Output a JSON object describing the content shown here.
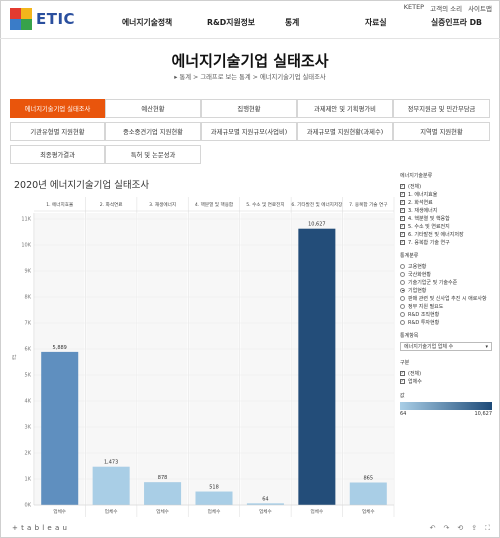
{
  "header": {
    "logo_text": "ETIC",
    "utility_links": [
      "KETEP",
      "고객의 소리",
      "사이트맵"
    ],
    "menu": [
      "에너지기술정책",
      "R&D지원정보",
      "통계",
      "자료실",
      "실증인프라 DB"
    ]
  },
  "page": {
    "title": "에너지기술기업 실태조사",
    "breadcrumb": "▸ 통계 > 그래프로 보는 통계 > 에너지기술기업 실태조사"
  },
  "tabs": [
    "에너지기술기업 실태조사",
    "예산현황",
    "집행현황",
    "과제제안 및 기획평가비",
    "정부지원금 및 민간부담금",
    "기관유형별 지원현황",
    "중소중견기업 지원현황",
    "과제규모별 지원규모(사업비)",
    "과제규모별 지원현황(과제수)",
    "지역별 지원현황",
    "최종평가결과",
    "특허 및 논문성과"
  ],
  "viz": {
    "title": "2020년 에너지기술기업 실태조사",
    "y_axis_title": "값",
    "brand": "+ t a b l e a u"
  },
  "chart_data": {
    "type": "bar",
    "title": "2020년 에너지기술기업 실태조사",
    "ylabel": "값",
    "ylim": [
      0,
      11000
    ],
    "yticks": [
      "0K",
      "1K",
      "2K",
      "3K",
      "4K",
      "5K",
      "6K",
      "7K",
      "8K",
      "9K",
      "10K",
      "11K"
    ],
    "categories": [
      "1. 에너지효율",
      "2. 화석연료",
      "3. 재생에너지",
      "4. 핵분열 및 핵융합",
      "5. 수소 및 연료전지",
      "6. 기타발전 및 에너지저장",
      "7. 융복합 기술 연구"
    ],
    "x_label": "업체수",
    "values": [
      5889,
      1473,
      878,
      518,
      64,
      10627,
      865
    ],
    "value_labels": [
      "5,889",
      "1,473",
      "878",
      "518",
      "64",
      "10,627",
      "865"
    ],
    "colors": [
      "#5f8fbf",
      "#a9cee6",
      "#a9cee6",
      "#a9cee6",
      "#a9cee6",
      "#234d79",
      "#a9cee6"
    ],
    "grid": true
  },
  "filters": {
    "field_title": "에너지기술분류",
    "field_items": [
      {
        "label": "(전체)",
        "checked": true
      },
      {
        "label": "1. 에너지효율",
        "checked": true
      },
      {
        "label": "2. 화석연료",
        "checked": true
      },
      {
        "label": "3. 재생에너지",
        "checked": true
      },
      {
        "label": "4. 핵분열 및 핵융합",
        "checked": true
      },
      {
        "label": "5. 수소 및 연료전지",
        "checked": true
      },
      {
        "label": "6. 기타발전 및 에너지저장",
        "checked": true
      },
      {
        "label": "7. 융복합 기술 연구",
        "checked": true
      }
    ],
    "stat_title": "통계분류",
    "stat_items": [
      {
        "label": "고용현황",
        "selected": false
      },
      {
        "label": "국산화현황",
        "selected": false
      },
      {
        "label": "기술기업군 및 기술수준",
        "selected": false
      },
      {
        "label": "기업현황",
        "selected": true
      },
      {
        "label": "판매 관련 및 신사업 추진 시 애로사항",
        "selected": false
      },
      {
        "label": "정부 지원 필요도",
        "selected": false
      },
      {
        "label": "R&D 조직현황",
        "selected": false
      },
      {
        "label": "R&D 투자현황",
        "selected": false
      }
    ],
    "item_title": "통계항목",
    "item_selected": "에너지기술기업 업체 수",
    "div_title": "구분",
    "div_items": [
      {
        "label": "(전체)",
        "checked": true
      },
      {
        "label": "업체수",
        "checked": true
      }
    ],
    "legend_title": "값",
    "legend_min": "64",
    "legend_max": "10,627"
  }
}
